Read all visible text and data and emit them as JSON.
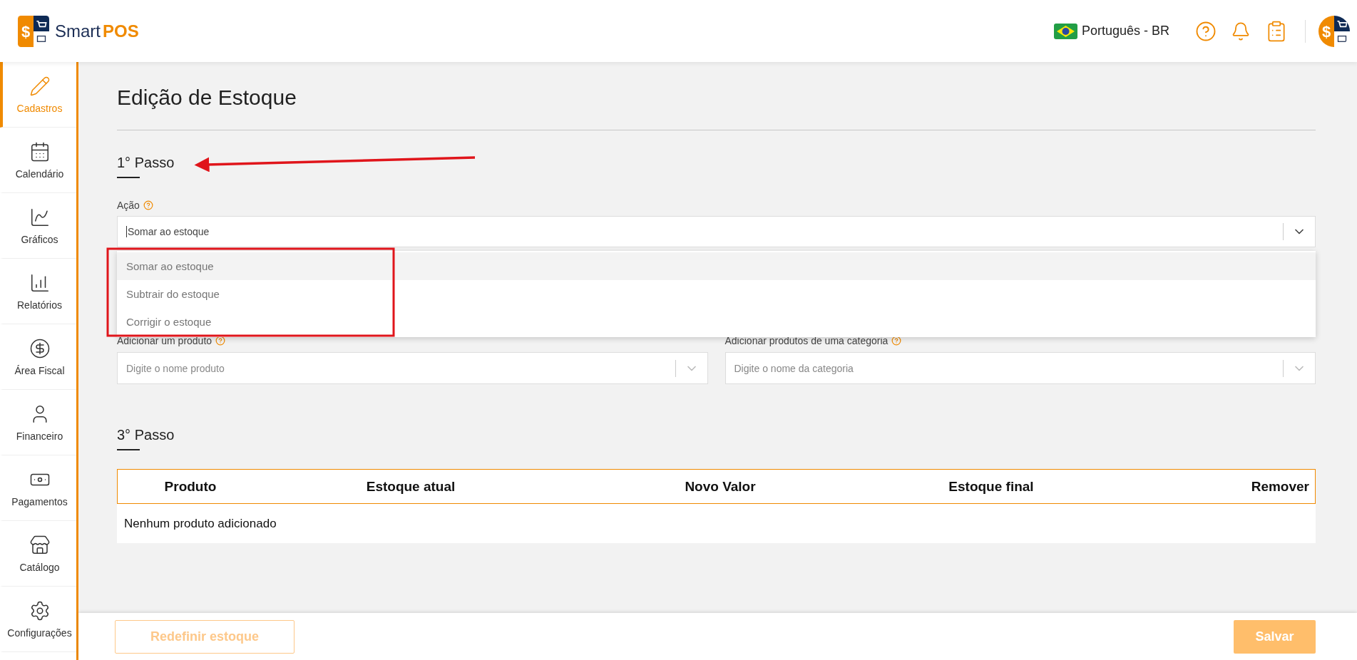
{
  "header": {
    "logo_symbol": "$",
    "brand": "Smart",
    "brand_accent": "POS",
    "language": "Português - BR",
    "avatar_symbol": "$"
  },
  "sidebar": {
    "items": [
      {
        "label": "Cadastros",
        "selected": true
      },
      {
        "label": "Calendário",
        "selected": false
      },
      {
        "label": "Gráficos",
        "selected": false
      },
      {
        "label": "Relatórios",
        "selected": false
      },
      {
        "label": "Área Fiscal",
        "selected": false
      },
      {
        "label": "Financeiro",
        "selected": false
      },
      {
        "label": "Pagamentos",
        "selected": false
      },
      {
        "label": "Catálogo",
        "selected": false
      },
      {
        "label": "Configurações",
        "selected": false
      }
    ]
  },
  "page": {
    "title": "Edição de Estoque"
  },
  "step_1": {
    "heading": "1° Passo",
    "action_label": "Ação",
    "action_value": "Somar ao estoque",
    "options": [
      {
        "label": "Somar ao estoque",
        "selected": true
      },
      {
        "label": "Subtrair do estoque",
        "selected": false
      },
      {
        "label": "Corrigir o estoque",
        "selected": false
      }
    ]
  },
  "step_2": {
    "fields": [
      {
        "label": "Adicionar um produto",
        "placeholder": "Digite o nome produto"
      },
      {
        "label": "Adicionar produtos de uma categoria",
        "placeholder": "Digite o nome da categoria"
      }
    ]
  },
  "step_3": {
    "heading": "3° Passo",
    "table": {
      "columns": [
        "Produto",
        "Estoque atual",
        "Novo Valor",
        "Estoque final",
        "Remover"
      ],
      "empty_message": "Nenhum produto adicionado"
    }
  },
  "footer": {
    "buttons": [
      {
        "kind": "outline",
        "label": "Redefinir estoque",
        "disabled": true
      },
      {
        "kind": "solid",
        "label": "Salvar",
        "disabled": true
      }
    ]
  }
}
